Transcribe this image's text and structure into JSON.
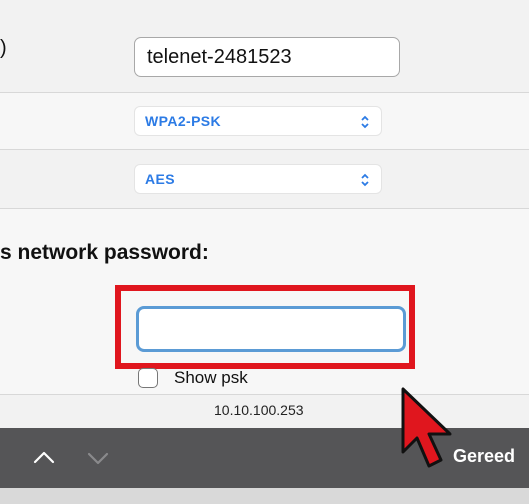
{
  "ssid_row": {
    "label_fragment": ")",
    "value": "telenet-2481523"
  },
  "auth_row": {
    "selected": "WPA2-PSK"
  },
  "encryption_row": {
    "selected": "AES"
  },
  "password_row": {
    "heading": "s network password:",
    "value": "",
    "show_psk_label": "Show psk",
    "show_psk_checked": false
  },
  "ip_row": {
    "value": "10.10.100.253"
  },
  "toolbar": {
    "done_label": "Gereed"
  },
  "colors": {
    "accent_blue": "#2c7be5",
    "highlight_red": "#e0161e",
    "toolbar_bg": "#555557",
    "focus_blue": "#5b9bd5"
  },
  "icons": {
    "select_arrows": "up-down-arrows-icon",
    "prev": "chevron-up-icon",
    "next": "chevron-down-icon",
    "cursor": "mouse-pointer-icon"
  }
}
